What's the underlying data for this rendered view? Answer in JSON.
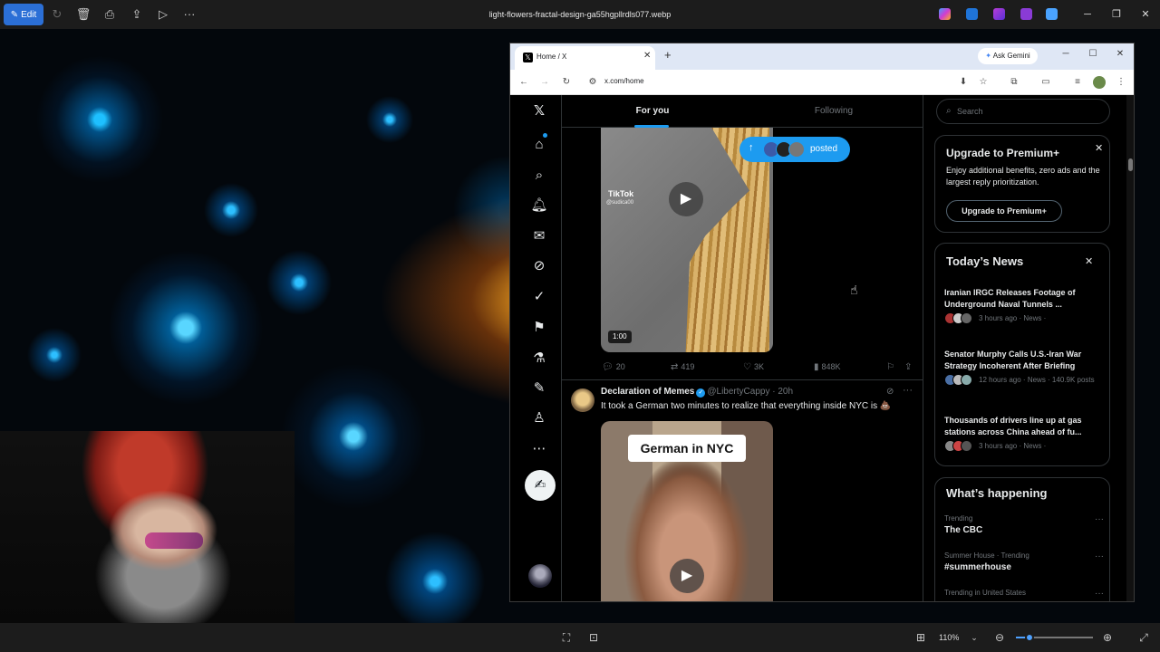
{
  "viewer": {
    "edit_label": "Edit",
    "file_title": "light-flowers-fractal-design-ga55hgpllrdls077.webp",
    "zoom_level": "110%",
    "zoom_fraction": 0.18
  },
  "browser": {
    "tab_title": "Home / X",
    "gemini_label": "Ask Gemini",
    "url": "x.com/home"
  },
  "feed": {
    "tabs": [
      "For you",
      "Following"
    ],
    "new_posts_pill": "posted",
    "tweet1": {
      "tiktok_brand": "TikTok",
      "tiktok_user": "@sudica00",
      "duration": "1:00",
      "replies": "20",
      "reposts": "419",
      "likes": "3K",
      "views": "848K"
    },
    "tweet2": {
      "name": "Declaration of Memes",
      "handle": "@LibertyCappy",
      "time": "· 20h",
      "text": "It took a German two minutes to realize that everything inside NYC is 💩",
      "video_caption": "German in NYC"
    }
  },
  "sidebar": {
    "search_placeholder": "Search",
    "premium": {
      "title": "Upgrade to Premium+",
      "body": "Enjoy additional benefits, zero ads and the largest reply prioritization.",
      "button": "Upgrade to Premium+"
    },
    "news": {
      "title": "Today’s News",
      "items": [
        {
          "headline": "Iranian IRGC Releases Footage of Underground Naval Tunnels ...",
          "meta": "3 hours ago · News ·"
        },
        {
          "headline": "Senator Murphy Calls U.S.-Iran War Strategy Incoherent After Briefing",
          "meta": "12 hours ago · News · 140.9K posts"
        },
        {
          "headline": "Thousands of drivers line up at gas stations across China ahead of fu...",
          "meta": "3 hours ago · News ·"
        }
      ]
    },
    "happening": {
      "title": "What’s happening",
      "trends": [
        {
          "meta": "Trending",
          "name": "The CBC"
        },
        {
          "meta": "Summer House · Trending",
          "name": "#summerhouse"
        },
        {
          "meta": "Trending in United States",
          "name": ""
        }
      ]
    }
  },
  "colors": {
    "accent": "#1d9bf0",
    "x_background": "#000000",
    "border": "#2f3336",
    "muted_text": "#71767b",
    "viewer_chrome": "#1c1c1c",
    "edit_button": "#2b6fd6"
  },
  "icons": {
    "nav": [
      "x-logo-icon",
      "home-icon",
      "search-icon",
      "bell-icon",
      "mail-icon",
      "grok-icon",
      "verified-icon",
      "bookmark-icon",
      "flask-icon",
      "edit-icon",
      "person-icon",
      "more-circle-icon",
      "compose-icon"
    ]
  }
}
